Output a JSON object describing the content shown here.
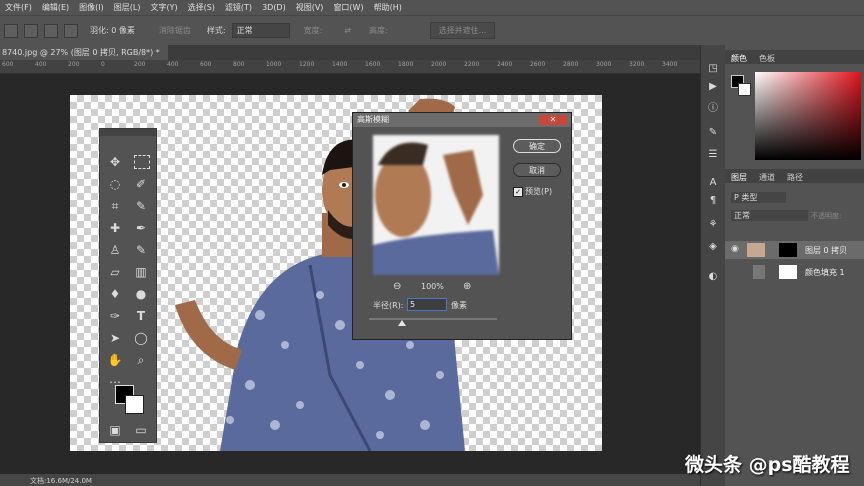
{
  "menu": [
    "文件(F)",
    "编辑(E)",
    "图像(I)",
    "图层(L)",
    "文字(Y)",
    "选择(S)",
    "滤镜(T)",
    "3D(D)",
    "视图(V)",
    "窗口(W)",
    "帮助(H)"
  ],
  "options": {
    "feather_label": "羽化: 0 像素",
    "antialias_label": "消除锯齿",
    "style_label": "样式:",
    "style_value": "正常",
    "width_label": "宽度:",
    "height_label": "高度:",
    "select_mask_button": "选择并遮住..."
  },
  "document_tab": "8740.jpg @ 27% (图层 0 拷贝, RGB/8*) *",
  "ruler_ticks": [
    "600",
    "400",
    "200",
    "0",
    "200",
    "400",
    "600",
    "800",
    "1000",
    "1200",
    "1400",
    "1600",
    "1800",
    "2000",
    "2200",
    "2400",
    "2600",
    "2800",
    "3000",
    "3200",
    "3400"
  ],
  "dialog": {
    "title": "高斯模糊",
    "ok": "确定",
    "cancel": "取消",
    "preview_label": "预览(P)",
    "zoom": "100%",
    "radius_label": "半径(R):",
    "radius_value": "5",
    "radius_unit": "像素"
  },
  "panels": {
    "color_tab": "颜色",
    "swatches_tab": "色板",
    "layers_tab": "图层",
    "channels_tab": "通道",
    "paths_tab": "路径",
    "kind_filter": "P 类型",
    "blend_mode": "正常",
    "opacity_label": "不透明度:",
    "layers": [
      {
        "name": "图层 0 拷贝"
      },
      {
        "name": "颜色填充 1"
      }
    ]
  },
  "status": {
    "doc_size": "文档:16.6M/24.0M"
  },
  "watermark": "微头条 @ps酷教程",
  "colors": {
    "foreground": "#000000",
    "background": "#ffffff",
    "accent": "#c8463c"
  }
}
